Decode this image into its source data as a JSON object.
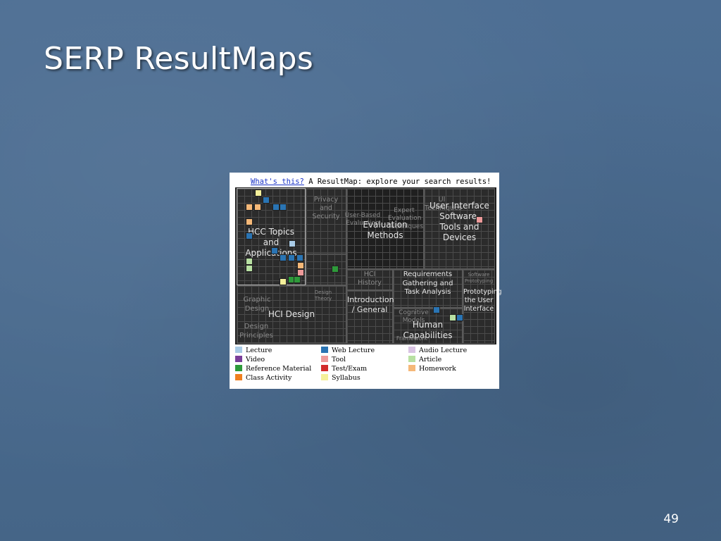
{
  "slide": {
    "title": "SERP ResultMaps",
    "page_number": "49"
  },
  "resultmap": {
    "header_link": "What's this?",
    "header_text": "A ResultMap: explore your search results!",
    "cells": {
      "hci_topics": "HCC Topics and Applications",
      "privacy": "Privacy and Security",
      "evaluation_methods": "Evaluation Methods",
      "user_based": "User-Based Evaluation",
      "expert_eval": "Expert Evaluation Techniques",
      "ui_techniques": "UI Techniques",
      "user_interface_software": "User Interface Software, Tools and Devices",
      "hci_history": "HCI History",
      "requirements": "Requirements Gathering and Task Analysis",
      "software_prototyping": "Software Prototyping",
      "prototyping": "Prototyping the User Interface",
      "graphic_design": "Graphic Design",
      "design_theory": "Design Theory",
      "hci_design": "HCI Design",
      "design_principles": "Design Principles",
      "introduction": "Introduction / General",
      "cognitive": "Cognitive Models",
      "human_capabilities": "Human Capabilities",
      "framework": "Framework"
    }
  },
  "legend": [
    {
      "label": "Lecture",
      "color": "#a9cbe6"
    },
    {
      "label": "Web Lecture",
      "color": "#2a74b3"
    },
    {
      "label": "Audio Lecture",
      "color": "#d9c3e3"
    },
    {
      "label": "Video",
      "color": "#7a3e9a"
    },
    {
      "label": "Tool",
      "color": "#ee9a9a"
    },
    {
      "label": "Article",
      "color": "#b8e0a2"
    },
    {
      "label": "Reference Material",
      "color": "#2e9a3a"
    },
    {
      "label": "Test/Exam",
      "color": "#d22a2a"
    },
    {
      "label": "Homework",
      "color": "#f5b878"
    },
    {
      "label": "Class Activity",
      "color": "#f07f1e"
    },
    {
      "label": "Syllabus",
      "color": "#f5f09a"
    }
  ]
}
